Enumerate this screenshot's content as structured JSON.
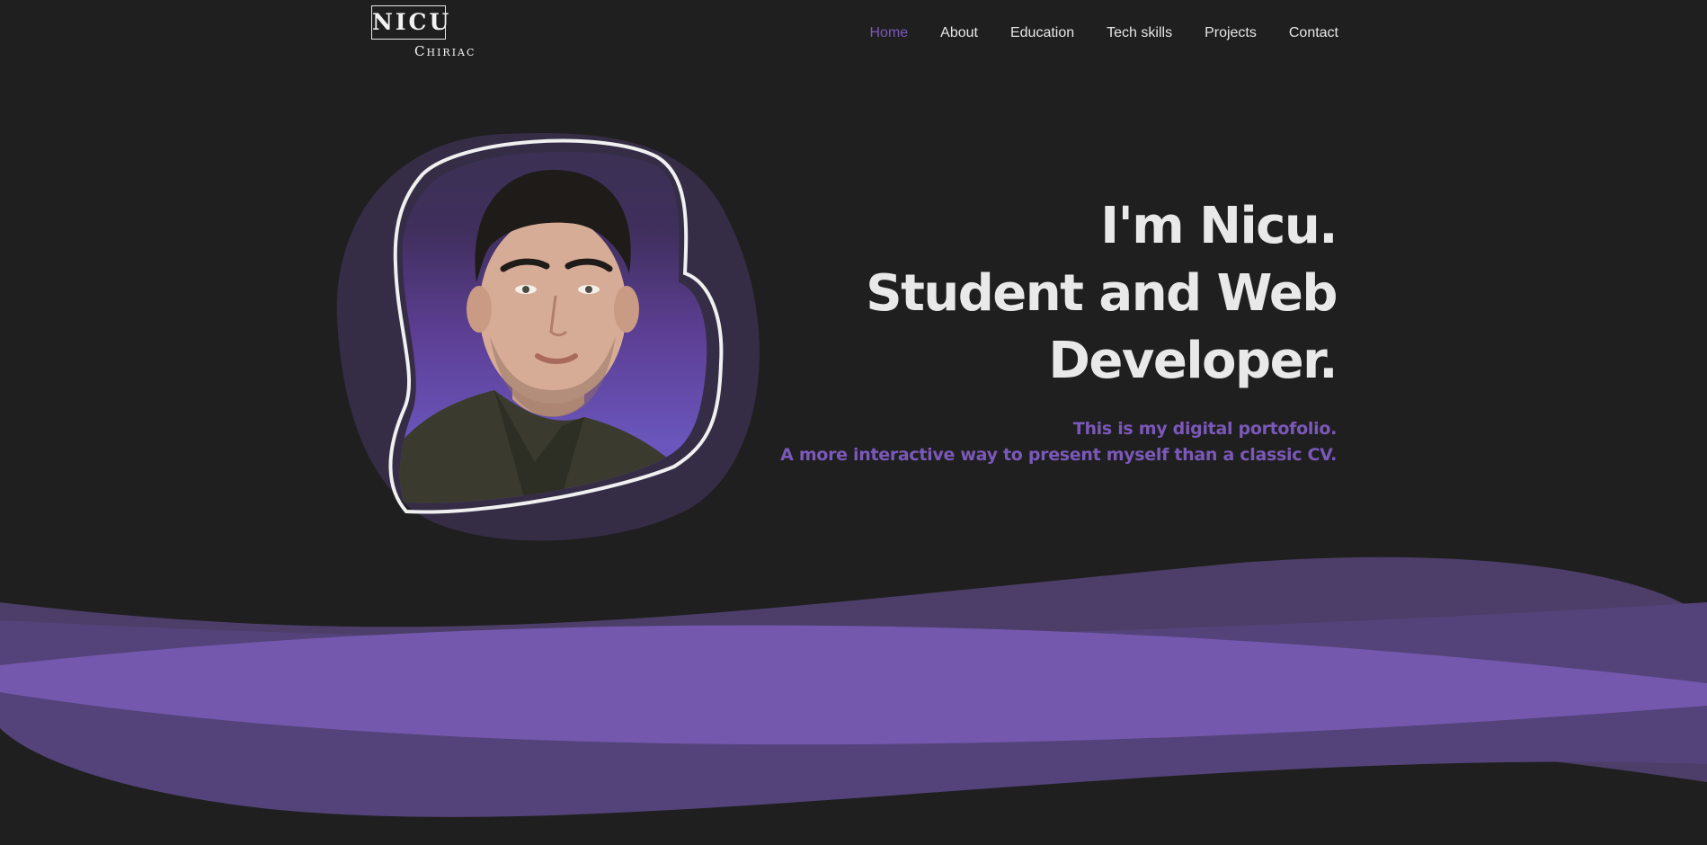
{
  "header": {
    "logo_main": "NICU",
    "logo_sub": "Chiriac",
    "nav": [
      {
        "label": "Home",
        "active": true
      },
      {
        "label": "About"
      },
      {
        "label": "Education"
      },
      {
        "label": "Tech skills"
      },
      {
        "label": "Projects"
      },
      {
        "label": "Contact"
      }
    ]
  },
  "hero": {
    "title_line1": "I'm Nicu.",
    "title_line2": "Student and Web",
    "title_line3": "Developer.",
    "subtitle_line1": "This is my digital portofolio.",
    "subtitle_line2": "A more interactive way to present myself than a classic CV."
  },
  "colors": {
    "background": "#1f1f1f",
    "accent": "#7b58b9",
    "text": "#e9e9e9"
  }
}
